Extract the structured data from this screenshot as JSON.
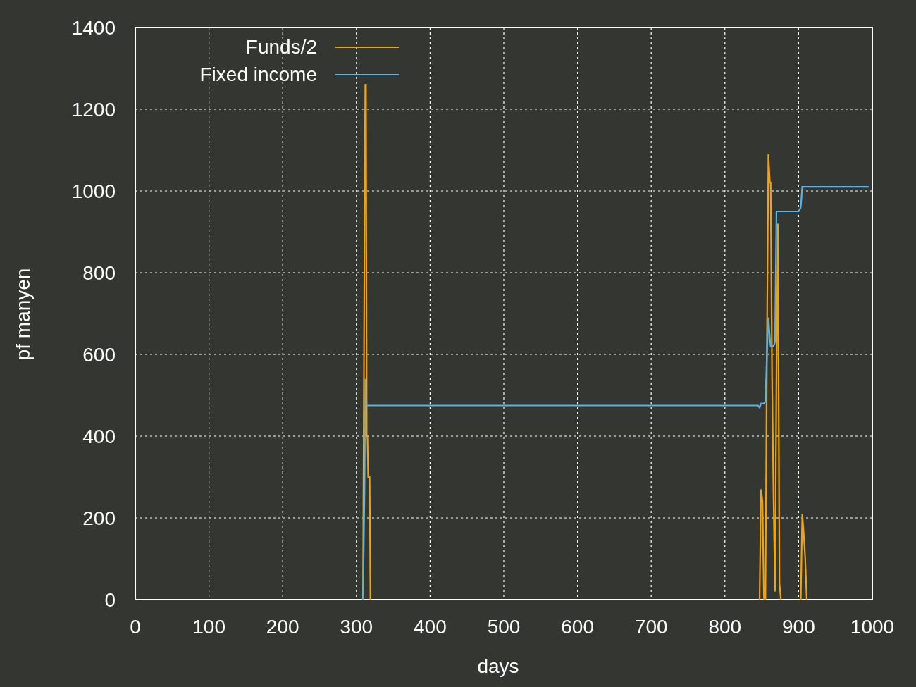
{
  "chart_data": {
    "type": "line",
    "xlabel": "days",
    "ylabel": "pf manyen",
    "xlim": [
      0,
      1000
    ],
    "ylim": [
      0,
      1400
    ],
    "xticks": [
      0,
      100,
      200,
      300,
      400,
      500,
      600,
      700,
      800,
      900,
      1000
    ],
    "yticks": [
      0,
      200,
      400,
      600,
      800,
      1000,
      1200,
      1400
    ],
    "grid": true,
    "legend": true,
    "x": [
      309,
      311,
      312,
      313,
      314,
      315,
      316,
      318,
      319,
      320,
      845,
      847,
      849,
      851,
      853,
      855,
      857,
      859,
      861,
      862,
      864,
      866,
      868,
      870,
      872,
      874,
      876,
      878,
      880,
      900,
      903,
      905,
      907,
      909,
      911,
      995
    ],
    "series": [
      {
        "name": "Funds/2",
        "color": "#f0a30a",
        "values": [
          0,
          900,
          1260,
          1260,
          400,
          400,
          300,
          300,
          0,
          null,
          null,
          0,
          270,
          240,
          0,
          0,
          620,
          1090,
          1020,
          1020,
          550,
          250,
          20,
          560,
          920,
          40,
          0,
          null,
          null,
          null,
          0,
          210,
          160,
          100,
          0,
          null
        ]
      },
      {
        "name": "Fixed income",
        "color": "#56b4e9",
        "values": [
          0,
          270,
          540,
          475,
          475,
          475,
          475,
          475,
          475,
          475,
          475,
          470,
          480,
          480,
          480,
          485,
          600,
          690,
          640,
          620,
          620,
          620,
          630,
          950,
          950,
          950,
          950,
          950,
          950,
          950,
          960,
          1010,
          1010,
          1010,
          1010,
          1010
        ]
      }
    ]
  }
}
